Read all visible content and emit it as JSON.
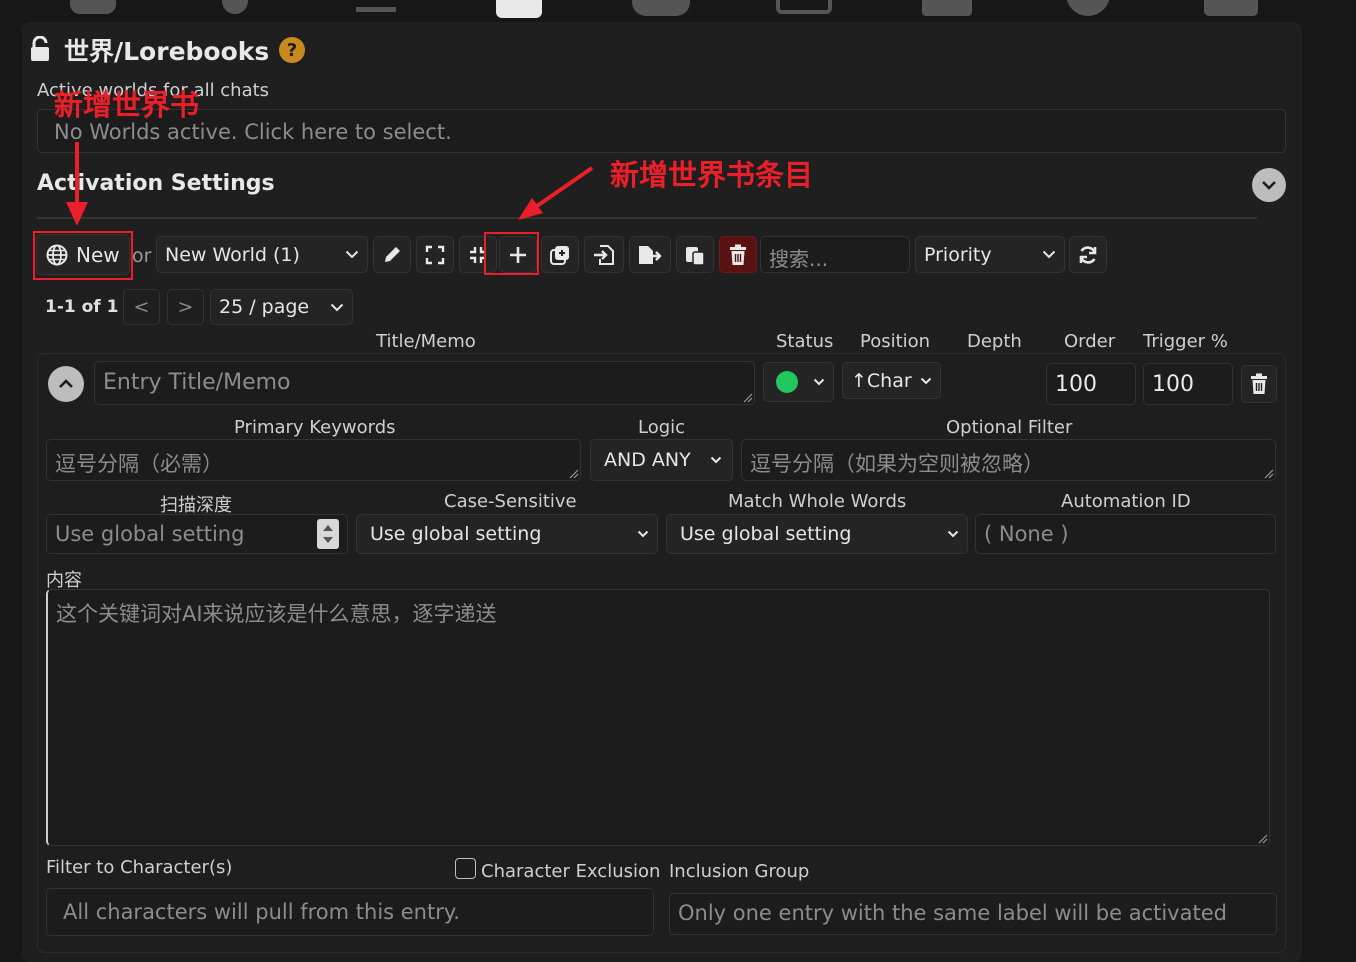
{
  "header": {
    "title": "世界/Lorebooks",
    "help_icon": "question-circle-icon"
  },
  "active_worlds": {
    "label": "Active worlds for all chats",
    "placeholder": "No Worlds active. Click here to select."
  },
  "activation": {
    "title": "Activation Settings"
  },
  "annotations": {
    "new_world": "新增世界书",
    "new_entry": "新增世界书条目"
  },
  "toolbar": {
    "new_label": "New",
    "or_label": "or",
    "world_select": "New World (1)",
    "search_placeholder": "搜索...",
    "sort_select": "Priority"
  },
  "pagination": {
    "range": "1-1 of 1",
    "prev": "<",
    "next": ">",
    "per_page": "25 / page"
  },
  "columns": {
    "title": "Title/Memo",
    "status": "Status",
    "position": "Position",
    "depth": "Depth",
    "order": "Order",
    "trigger": "Trigger %"
  },
  "entry": {
    "title_placeholder": "Entry Title/Memo",
    "position": "↑Char",
    "order": "100",
    "trigger": "100",
    "status_color": "#22c55e",
    "primary_keywords_label": "Primary Keywords",
    "primary_keywords_placeholder": "逗号分隔（必需）",
    "logic_label": "Logic",
    "logic_value": "AND ANY",
    "optional_filter_label": "Optional Filter",
    "optional_filter_placeholder": "逗号分隔（如果为空则被忽略）",
    "scan_depth_label": "扫描深度",
    "scan_depth_placeholder": "Use global setting",
    "case_label": "Case-Sensitive",
    "case_value": "Use global setting",
    "whole_label": "Match Whole Words",
    "whole_value": "Use global setting",
    "automation_label": "Automation ID",
    "automation_placeholder": "( None )",
    "content_label": "内容",
    "content_placeholder": "这个关键词对AI来说应该是什么意思，逐字递送",
    "filter_label": "Filter to Character(s)",
    "exclusion_label": "Character Exclusion",
    "inclusion_label": "Inclusion Group",
    "filter_placeholder": "All characters will pull from this entry.",
    "inclusion_placeholder": "Only one entry with the same label will be activated"
  },
  "colors": {
    "annotation": "#ea1f2a",
    "help": "#c8891e"
  }
}
